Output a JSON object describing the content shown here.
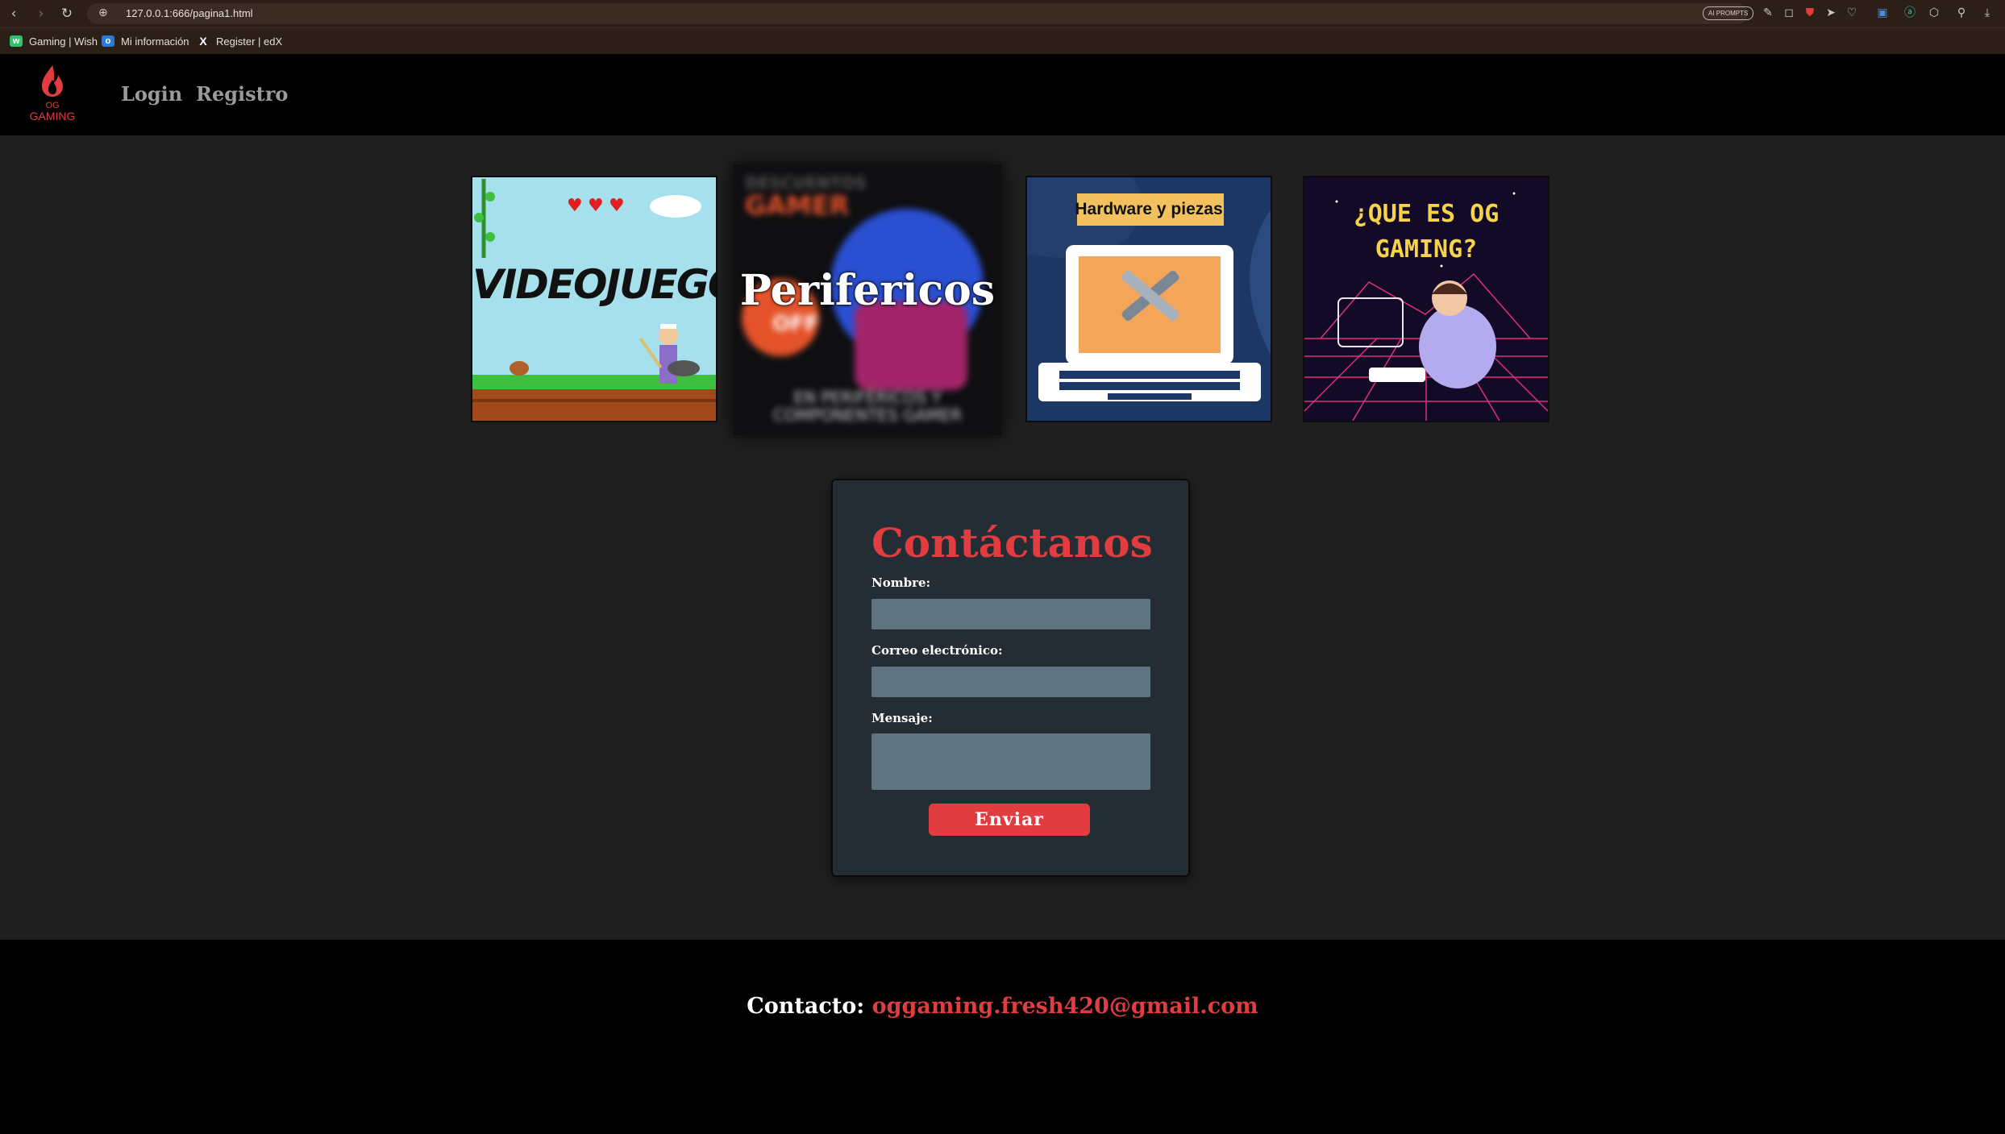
{
  "browser": {
    "url": "127.0.0.1:666/pagina1.html",
    "ai_pill": "AI PROMPTS",
    "bookmarks": [
      {
        "label": "Gaming | Wish",
        "icon": "wish-icon",
        "color": "#2fc36b"
      },
      {
        "label": "Mi información",
        "icon": "outlook-icon",
        "color": "#2a7ad8"
      },
      {
        "label": "Register | edX",
        "icon": "x-icon",
        "color": "#ffffff"
      }
    ]
  },
  "site": {
    "logo_text": "OG GAMING",
    "nav": [
      "Login",
      "Registro"
    ]
  },
  "cards": [
    {
      "label": "VIDEOJUEGOS",
      "icon": "videojuegos-pixel-art"
    },
    {
      "label": "Perifericos",
      "top_text": "GAMER",
      "bottom_text": "EN PERIFÉRICOS Y COMPONENTES GAMER",
      "badge": "OFF",
      "icon": "perifericos-blurred-ad"
    },
    {
      "label": "Hardware y piezas",
      "icon": "laptop-tools-icon"
    },
    {
      "label": "¿QUE ES OG GAMING?",
      "icon": "retro-gamer-illustration"
    }
  ],
  "contact": {
    "title": "Contáctanos",
    "name_label": "Nombre:",
    "email_label": "Correo electrónico:",
    "message_label": "Mensaje:",
    "submit": "Enviar"
  },
  "footer": {
    "label": "Contacto:",
    "email": "oggaming.fresh420@gmail.com"
  },
  "colors": {
    "accent": "#e13c3f",
    "background": "#1f1f1f",
    "header": "#000000"
  }
}
